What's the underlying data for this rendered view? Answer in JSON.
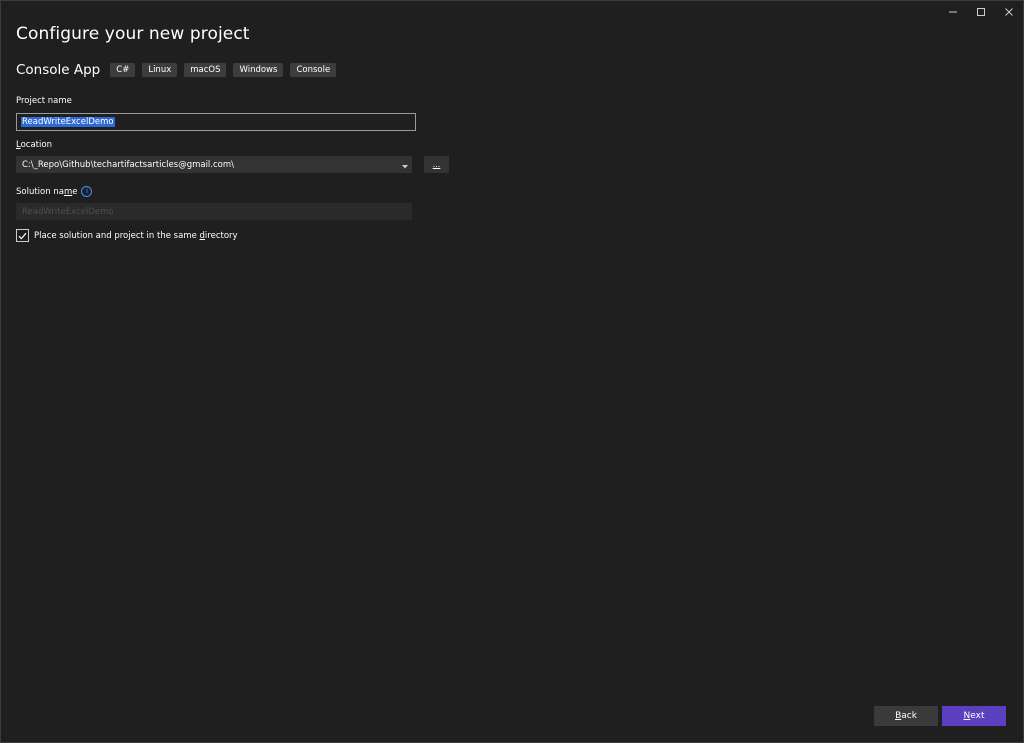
{
  "window": {
    "controls": [
      "minimize",
      "maximize",
      "close"
    ]
  },
  "page": {
    "title": "Configure your new project"
  },
  "template": {
    "name": "Console App",
    "tags": [
      "C#",
      "Linux",
      "macOS",
      "Windows",
      "Console"
    ]
  },
  "project_name": {
    "label": "Project name",
    "value": "ReadWriteExcelDemo"
  },
  "location": {
    "label_prefix": "L",
    "label_rest": "ocation",
    "value": "C:\\_Repo\\Github\\techartifactsarticles@gmail.com\\",
    "browse_label": "..."
  },
  "solution_name": {
    "label_prefix": "Solution na",
    "label_underlined": "m",
    "label_suffix": "e",
    "info_glyph": "i",
    "placeholder": "ReadWriteExcelDemo"
  },
  "same_directory": {
    "label_prefix": "Place solution and project in the same ",
    "label_underlined": "d",
    "label_suffix": "irectory",
    "checked": true
  },
  "footer": {
    "back_prefix": "",
    "back_underlined": "B",
    "back_suffix": "ack",
    "next_underlined": "N",
    "next_suffix": "ext"
  },
  "colors": {
    "background": "#1f1f1f",
    "accent": "#5a3fbe",
    "selection": "#2d6ad3",
    "info": "#3794ff"
  }
}
